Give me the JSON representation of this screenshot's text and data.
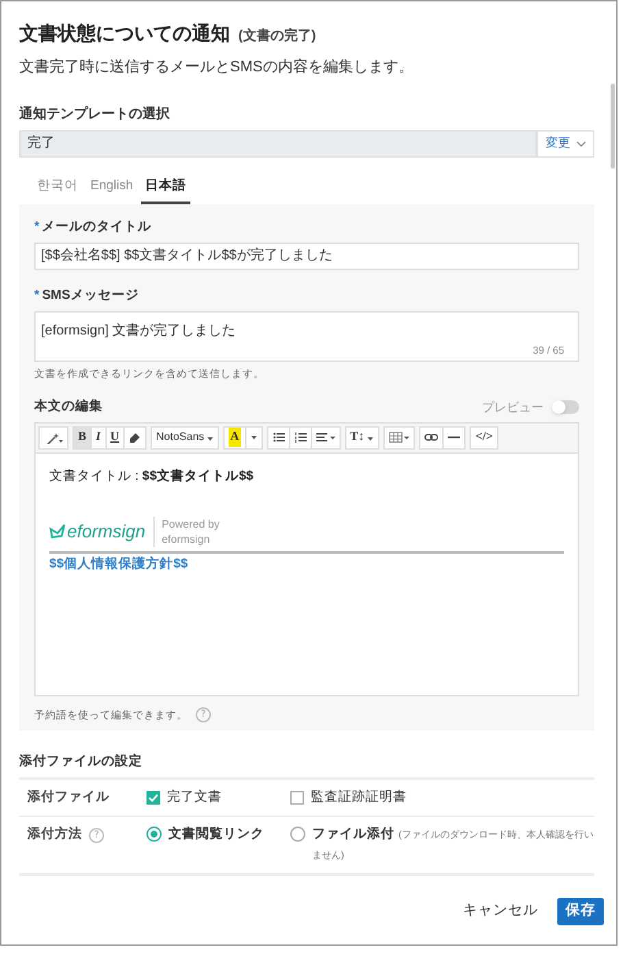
{
  "dialog": {
    "title": "文書状態についての通知",
    "title_note": "(文書の完了)",
    "subtitle": "文書完了時に送信するメールとSMSの内容を編集します。"
  },
  "template": {
    "label": "通知テンプレートの選択",
    "value": "完了",
    "change_button": "変更"
  },
  "tabs": [
    {
      "label": "한국어",
      "selected": false
    },
    {
      "label": "English",
      "selected": false
    },
    {
      "label": "日本語",
      "selected": true
    }
  ],
  "mail_title": {
    "label": "メールのタイトル",
    "required_mark": "*",
    "value": "[$$会社名$$] $$文書タイトル$$が完了しました"
  },
  "sms": {
    "label": "SMSメッセージ",
    "required_mark": "*",
    "value": "[eformsign] 文書が完了しました",
    "counter": "39 / 65",
    "hint": "文書を作成できるリンクを含めて送信します。"
  },
  "body_editor": {
    "label": "本文の編集",
    "preview_label": "プレビュー",
    "preview_on": false,
    "toolbar": [
      [
        {
          "kind": "wand",
          "active": false
        }
      ],
      [
        {
          "kind": "text",
          "label": "B",
          "active": true
        },
        {
          "kind": "text",
          "label": "I",
          "active": false
        },
        {
          "kind": "text",
          "label": "U",
          "active": false
        },
        {
          "kind": "eraser",
          "active": false
        }
      ],
      [
        {
          "kind": "dropdown",
          "label": "NotoSans",
          "active": false
        }
      ],
      [
        {
          "kind": "highlight",
          "label": "A",
          "active": false
        },
        {
          "kind": "caret",
          "active": false
        }
      ],
      [
        {
          "kind": "ul",
          "active": false
        },
        {
          "kind": "ol",
          "active": false
        },
        {
          "kind": "align",
          "active": false
        }
      ],
      [
        {
          "kind": "height",
          "label": "T↕",
          "active": false
        }
      ],
      [
        {
          "kind": "table",
          "active": false
        }
      ],
      [
        {
          "kind": "link",
          "active": false
        },
        {
          "kind": "hr",
          "active": false
        }
      ],
      [
        {
          "kind": "text",
          "label": "</>",
          "active": false
        }
      ]
    ],
    "content_line": "文書タイトル : **$$文書タイトル$$**",
    "logo_text": "eformsign",
    "powered_by": "Powered by",
    "powered_by_name": "eformsign",
    "policy_link": "$$個人情報保護方針$$",
    "hint": "予約語を使って編集できます。",
    "hint_help": "?"
  },
  "attachments": {
    "title": "添付ファイルの設定",
    "rows": [
      {
        "label": "添付ファイル",
        "kind": "checkbox",
        "options": [
          {
            "label": "完了文書",
            "selected": true
          },
          {
            "label": "監査証跡証明書",
            "selected": false
          }
        ]
      },
      {
        "label": "添付方法",
        "help": "?",
        "kind": "radio",
        "options": [
          {
            "label": "文書閲覧リンク",
            "selected": true
          },
          {
            "label": "ファイル添付",
            "note": "(ファイルのダウンロード時、本人確認を行いません)",
            "selected": false
          }
        ]
      }
    ]
  },
  "buttons": {
    "cancel": "キャンセル",
    "save": "保存"
  }
}
